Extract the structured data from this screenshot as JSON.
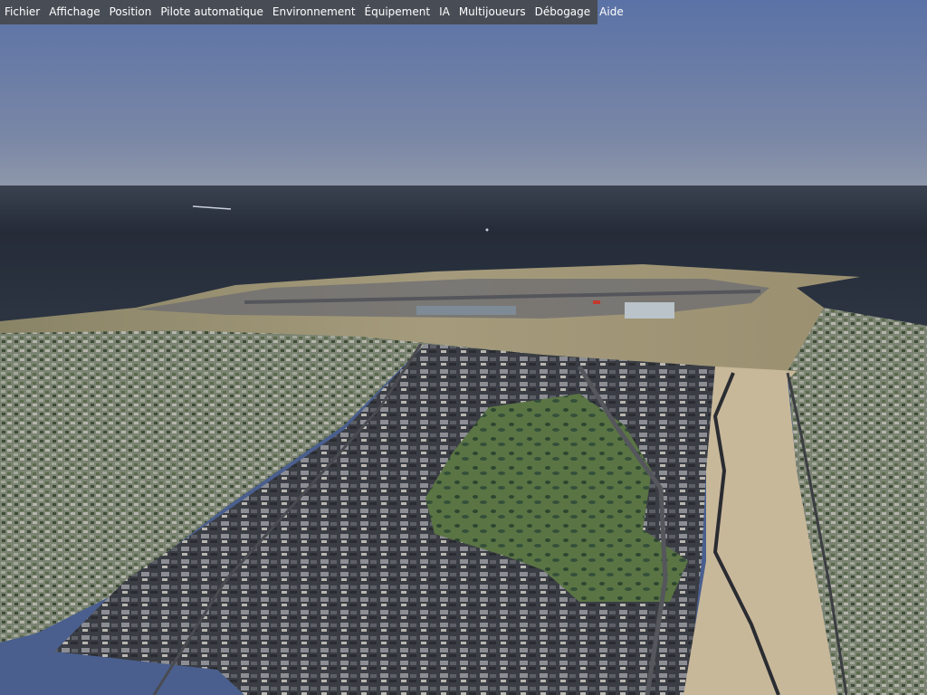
{
  "menubar": {
    "items": [
      {
        "label": "Fichier"
      },
      {
        "label": "Affichage"
      },
      {
        "label": "Position"
      },
      {
        "label": "Pilote automatique"
      },
      {
        "label": "Environnement"
      },
      {
        "label": "Équipement"
      },
      {
        "label": "IA"
      },
      {
        "label": "Multijoueurs"
      },
      {
        "label": "Débogage"
      },
      {
        "label": "Aide"
      }
    ]
  },
  "colors": {
    "sky_top": "#5a72a6",
    "sky_horizon": "#8e97aa",
    "sea": "#2a323e",
    "airfield": "#9a9070",
    "urban": "#7b8372",
    "industrial": "#3a3d44",
    "park": "#4e6a3c",
    "beach": "#c8b89a",
    "menubar": "#464a4e"
  }
}
